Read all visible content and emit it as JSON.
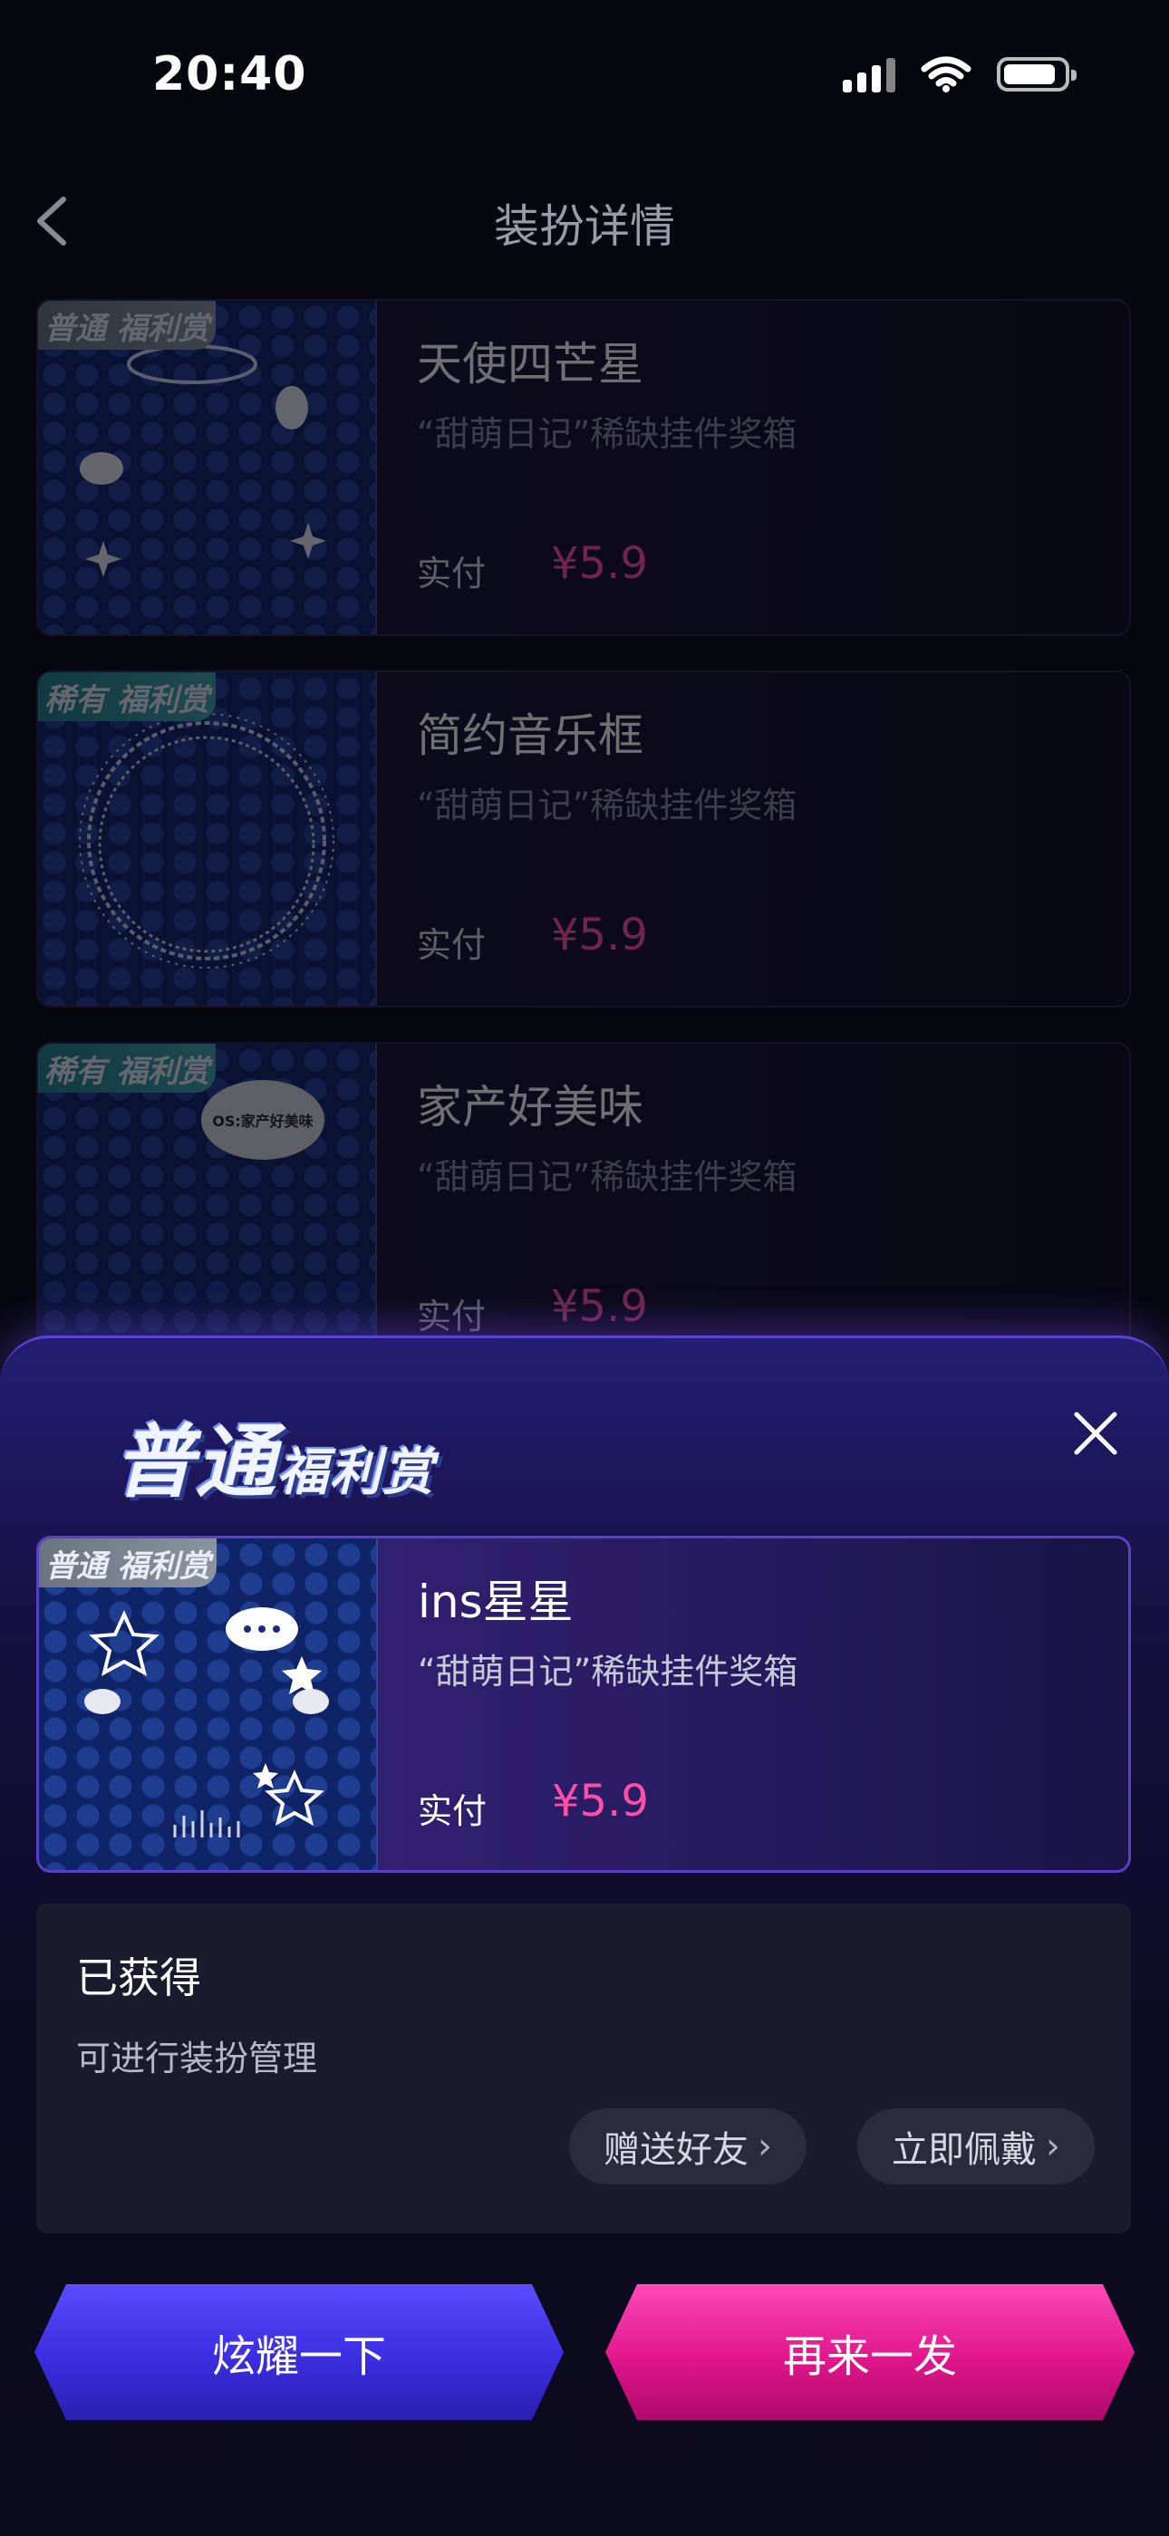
{
  "status_bar": {
    "time": "20:40"
  },
  "nav": {
    "title": "装扮详情"
  },
  "list": [
    {
      "tag": "普通 福利赏",
      "name": "天使四芒星",
      "desc": "“甜萌日记”稀缺挂件奖箱",
      "pay_label": "实付",
      "price": "¥5.9"
    },
    {
      "tag": "稀有 福利赏",
      "name": "简约音乐框",
      "desc": "“甜萌日记”稀缺挂件奖箱",
      "pay_label": "实付",
      "price": "¥5.9"
    },
    {
      "tag": "稀有 福利赏",
      "name": "家产好美味",
      "desc": "“甜萌日记”稀缺挂件奖箱",
      "pay_label": "实付",
      "price": "¥5.9",
      "bubble": "OS:家产好美味"
    }
  ],
  "sheet": {
    "logo_main": "普通",
    "logo_sub": "福利赏",
    "selected": {
      "tag": "普通 福利赏",
      "name": "ins星星",
      "desc": "“甜萌日记”稀缺挂件奖箱",
      "pay_label": "实付",
      "price": "¥5.9"
    },
    "info": {
      "title": "已获得",
      "subtitle": "可进行装扮管理",
      "gift_button": "赠送好友",
      "wear_button": "立即佩戴"
    },
    "buttons": {
      "show_off": "炫耀一下",
      "again": "再来一发"
    }
  }
}
